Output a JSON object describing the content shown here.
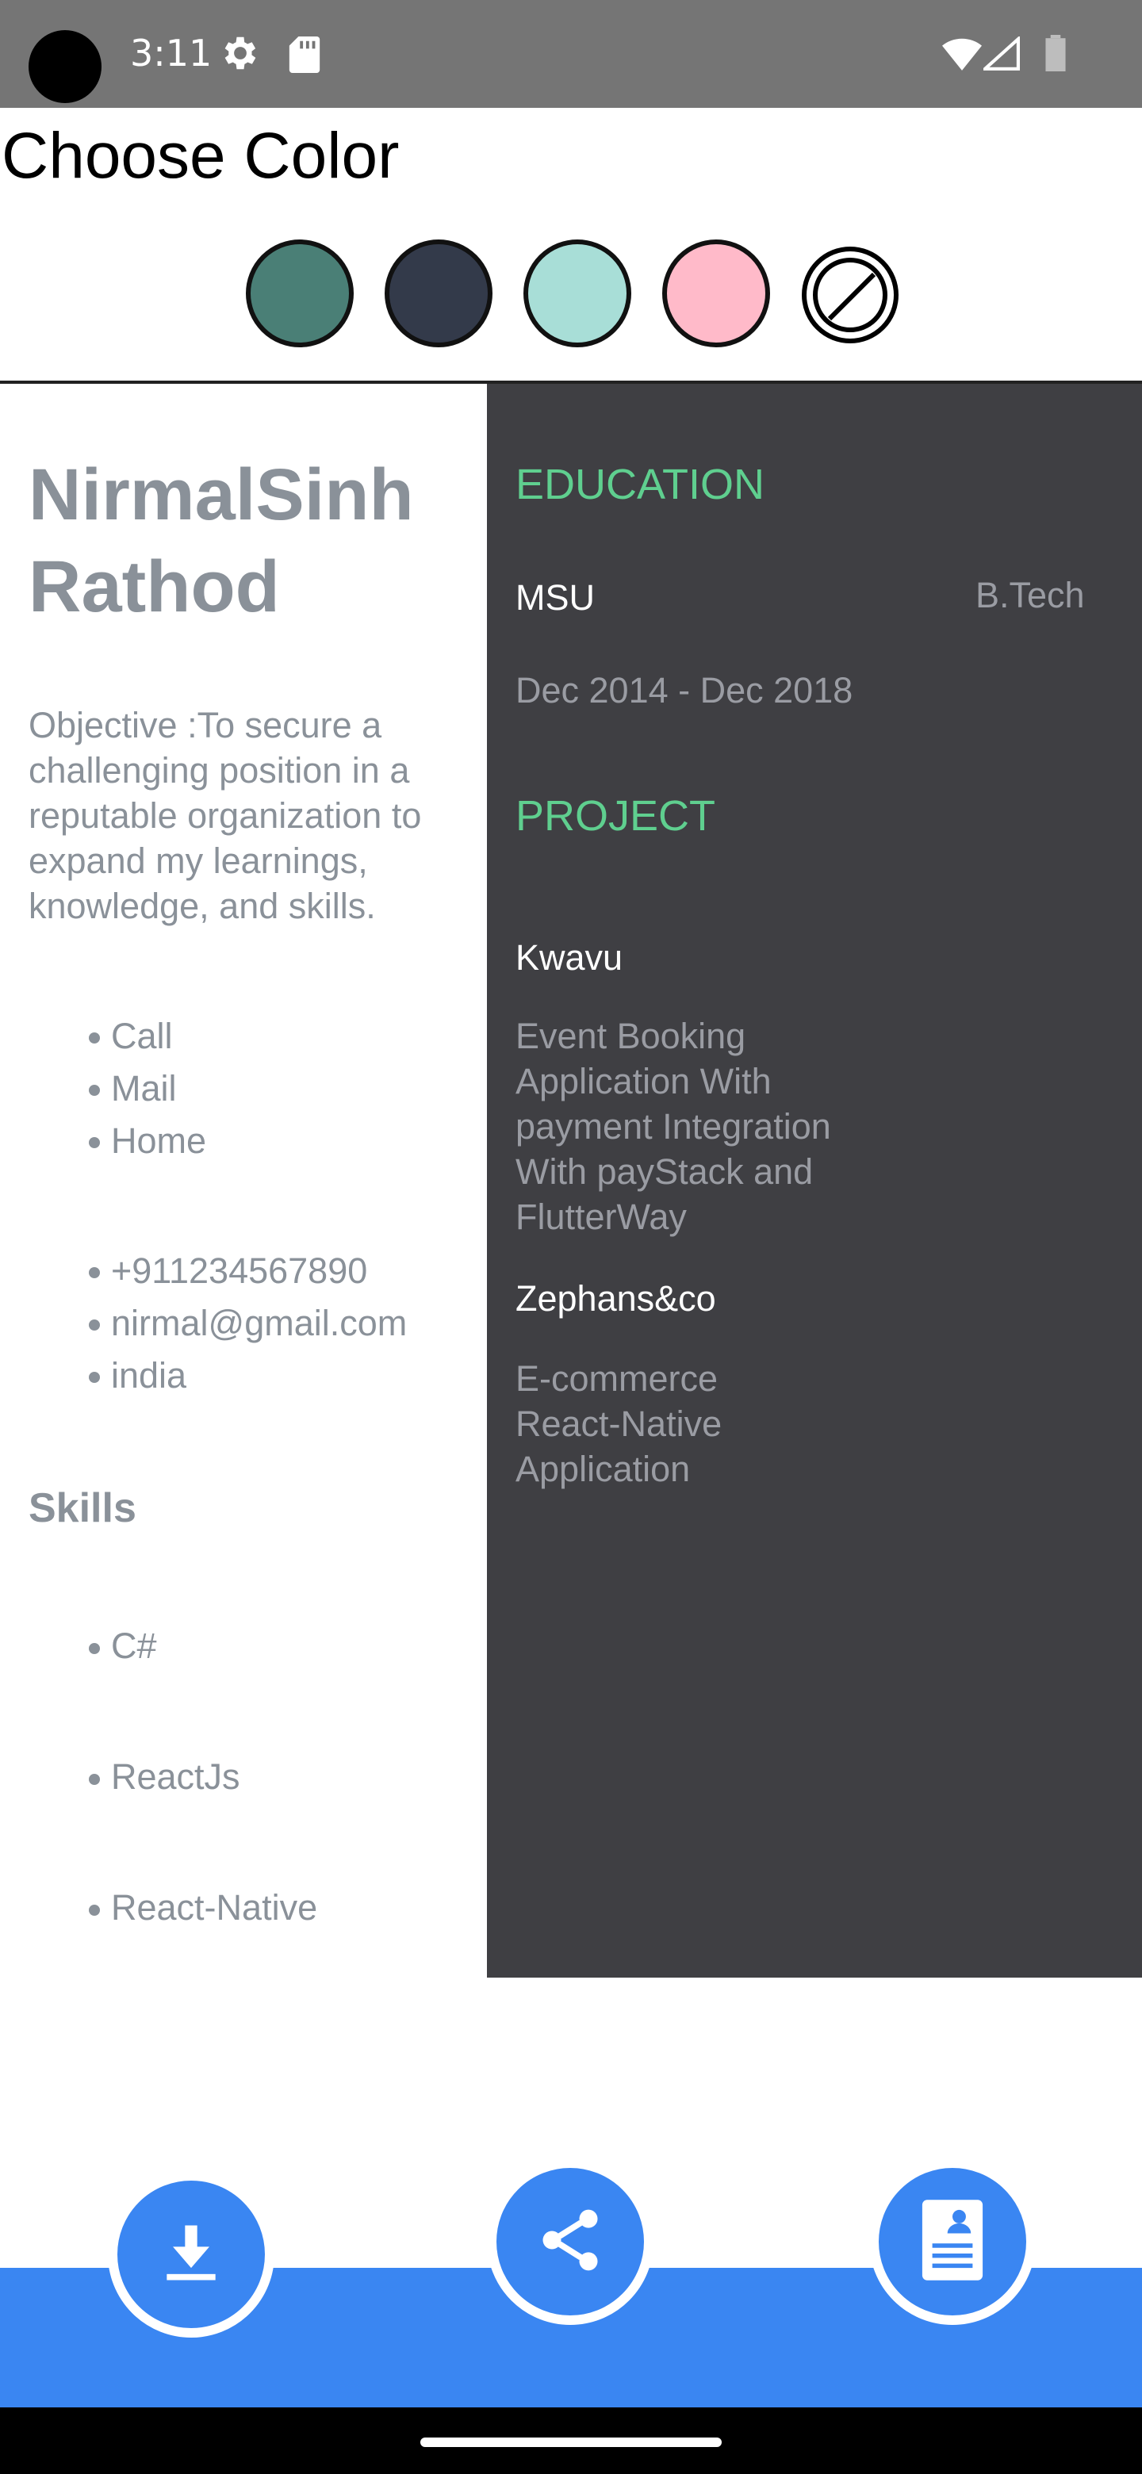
{
  "status_bar": {
    "time": "3:11",
    "icons": [
      "settings-gear-icon",
      "sd-card-icon",
      "wifi-icon",
      "cell-signal-icon",
      "battery-icon"
    ]
  },
  "color_picker": {
    "title": "Choose Color",
    "swatches": [
      {
        "name": "teal",
        "color": "#4a7f76"
      },
      {
        "name": "dark-slate",
        "color": "#333a4a"
      },
      {
        "name": "mint",
        "color": "#a8ded7"
      },
      {
        "name": "pink",
        "color": "#ffbac9"
      }
    ],
    "no_color_icon": "block-icon"
  },
  "resume": {
    "first_name": "NirmalSinh",
    "last_name": "Rathod",
    "objective": "Objective :To secure a challenging position in a reputable organization to expand my learnings, knowledge, and skills.",
    "contact_labels": [
      "Call",
      "Mail",
      "Home"
    ],
    "contact_values": [
      "+911234567890",
      "nirmal@gmail.com",
      "india"
    ],
    "skills_title": "Skills",
    "skills": [
      "C#",
      "ReactJs",
      "React-Native"
    ],
    "education": {
      "heading": "EDUCATION",
      "school": "MSU",
      "degree": "B.Tech",
      "period": "Dec 2014 - Dec 2018"
    },
    "projects": {
      "heading": "PROJECT",
      "items": [
        {
          "name": "Kwavu",
          "description": "Event Booking Application With payment Integration With payStack and FlutterWay"
        },
        {
          "name": "Zephans&co",
          "description": "E-commerce React-Native Application"
        }
      ]
    }
  },
  "actions": {
    "download_icon": "download-icon",
    "share_icon": "share-icon",
    "resume_icon": "resume-document-icon"
  },
  "colors": {
    "accent_blue": "#3a86f2",
    "panel_dark": "#3f3f43",
    "heading_green": "#5fcf8f",
    "text_grey": "#8a9199"
  }
}
